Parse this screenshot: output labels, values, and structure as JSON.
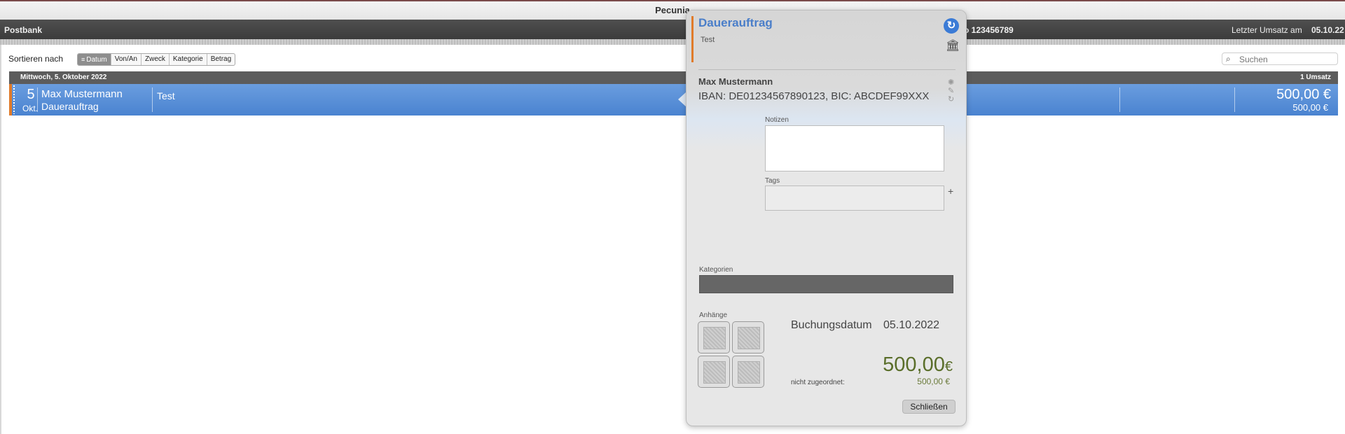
{
  "window": {
    "title": "Pecunia"
  },
  "account_bar": {
    "bank": "Postbank",
    "account_number_fragment": "o  123456789",
    "last_turnover_label": "Letzter Umsatz am",
    "last_turnover_value": "05.10.22"
  },
  "sort": {
    "label": "Sortieren nach",
    "options": [
      "Datum",
      "Von/An",
      "Zweck",
      "Kategorie",
      "Betrag"
    ],
    "active": "Datum"
  },
  "search": {
    "placeholder": "Suchen"
  },
  "group": {
    "date": "Mittwoch, 5. Oktober 2022",
    "count": "1 Umsatz"
  },
  "transaction": {
    "day": "5",
    "month": "Okt.",
    "name": "Max Mustermann",
    "type": "Dauerauftrag",
    "purpose": "Test",
    "amount": "500,00 €",
    "amount_secondary": "500,00 €",
    "colors": {
      "row": "#4a83d0",
      "marker": "#e07b2a"
    }
  },
  "popover": {
    "title": "Dauerauftrag",
    "subtitle": "Test",
    "person": "Max Mustermann",
    "iban": "IBAN: DE01234567890123, BIC: ABCDEF99XXX",
    "notes_label": "Notizen",
    "notes_value": "",
    "tags_label": "Tags",
    "categories_label": "Kategorien",
    "attachments_label": "Anhänge",
    "booking_date_label": "Buchungsdatum",
    "booking_date_value": "05.10.2022",
    "amount": "500,00",
    "amount_currency": "€",
    "unassigned_label": "nicht zugeordnet:",
    "unassigned_value": "500,00 €",
    "close_label": "Schließen",
    "colors": {
      "title": "#4a7ec9",
      "amount": "#5a6e2a",
      "accent": "#e07b2a"
    }
  }
}
